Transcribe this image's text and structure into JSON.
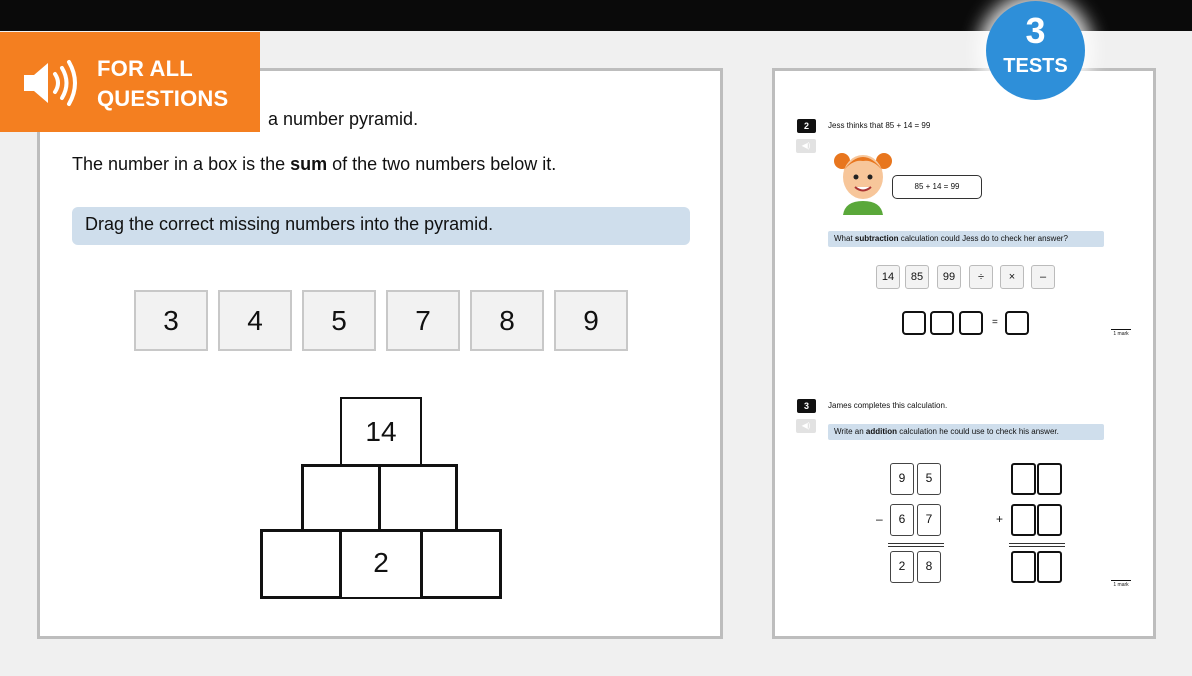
{
  "audio_badge": {
    "line1": "FOR ALL",
    "line2": "QUESTIONS",
    "icon": "speaker-icon"
  },
  "tests_badge": {
    "number": "3",
    "label": "TESTS"
  },
  "left": {
    "intro_tail": "a number pyramid.",
    "sum_prefix": "The number in a box is the ",
    "sum_bold": "sum",
    "sum_suffix": " of the two numbers below it.",
    "instruction": "Drag the correct missing numbers into the pyramid.",
    "tiles": [
      "3",
      "4",
      "5",
      "7",
      "8",
      "9"
    ],
    "pyramid": {
      "top": "14",
      "bottom_middle": "2"
    }
  },
  "right": {
    "q2": {
      "number": "2",
      "text": "Jess thinks that 85 + 14 = 99",
      "bubble": "85 + 14 = 99",
      "prompt_prefix": "What ",
      "prompt_bold": "subtraction",
      "prompt_suffix": " calculation could Jess do to check her answer?",
      "chips": [
        "14",
        "85",
        "99",
        "÷",
        "×",
        "–"
      ],
      "equals": "=",
      "mark": "1 mark"
    },
    "q3": {
      "number": "3",
      "text": "James completes this calculation.",
      "prompt_prefix": "Write an ",
      "prompt_bold": "addition",
      "prompt_suffix": " calculation he could use to check his answer.",
      "row1": [
        "9",
        "5"
      ],
      "minus": "–",
      "row2": [
        "6",
        "7"
      ],
      "answer": [
        "2",
        "8"
      ],
      "plus": "+",
      "mark": "1 mark"
    }
  }
}
